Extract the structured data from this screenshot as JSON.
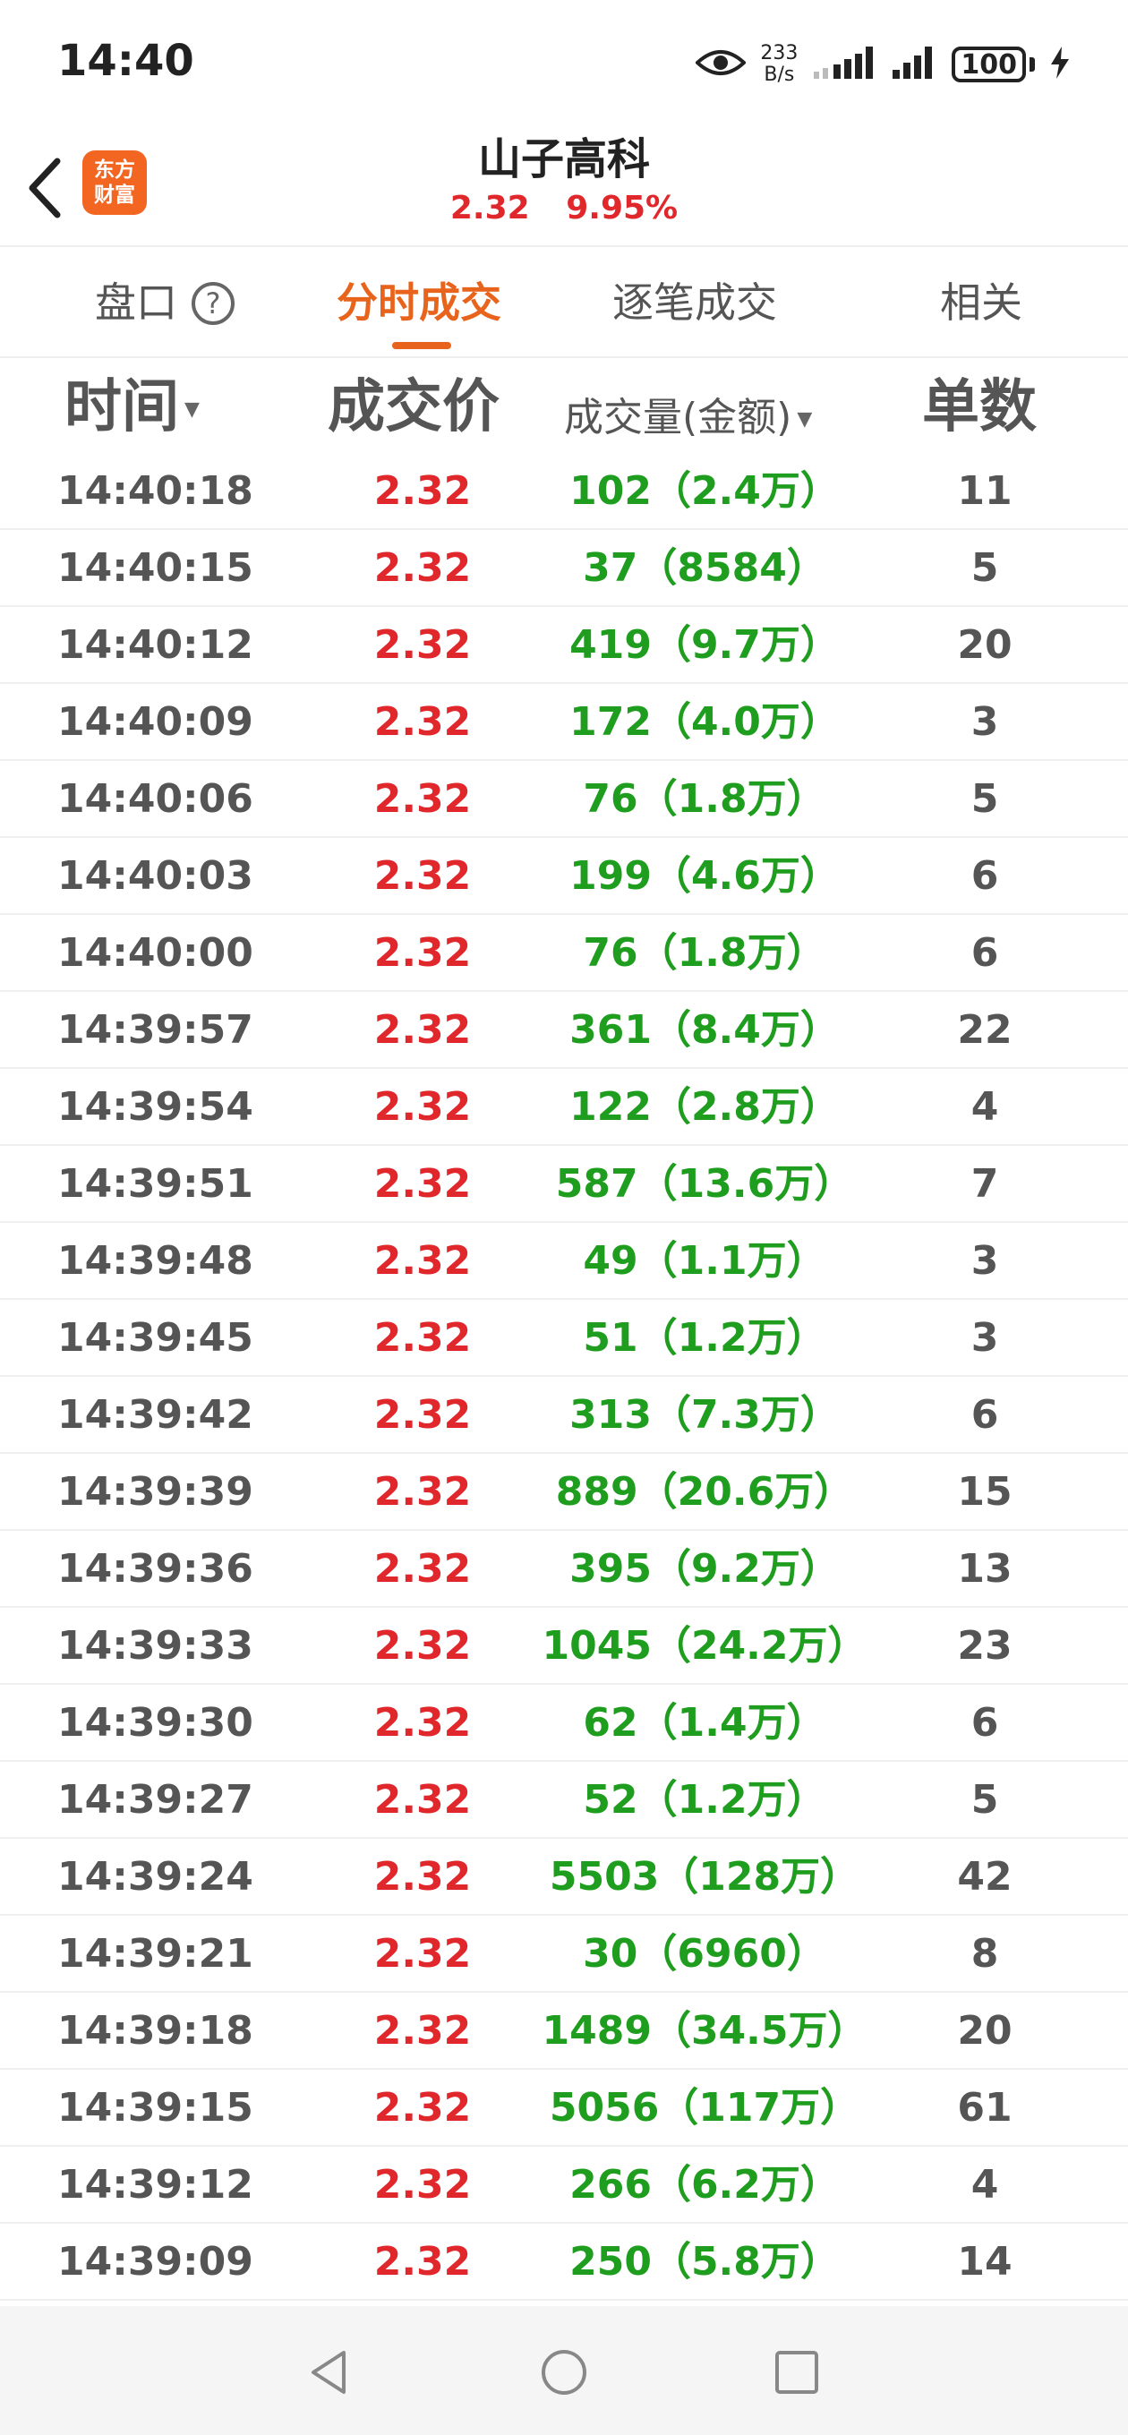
{
  "status_bar": {
    "time": "14:40",
    "net_speed_value": "233",
    "net_speed_unit": "B/s",
    "battery": "100",
    "icons": [
      "eye-icon",
      "signal-icon",
      "signal-icon",
      "charging-icon"
    ]
  },
  "header": {
    "back_icon": "chevron-left-icon",
    "logo_line1": "东方",
    "logo_line2": "财富",
    "title": "山子高科",
    "price": "2.32",
    "change_pct": "9.95%"
  },
  "tabs": [
    {
      "label": "盘口",
      "active": false
    },
    {
      "label": "分时成交",
      "active": true
    },
    {
      "label": "逐笔成交",
      "active": false
    },
    {
      "label": "相关",
      "active": false
    }
  ],
  "table": {
    "headers": {
      "time": "时间",
      "price": "成交价",
      "volume": "成交量(金额)",
      "count": "单数"
    },
    "rows": [
      {
        "time": "14:40:18",
        "price": "2.32",
        "volume": "102（2.4万）",
        "count": "11"
      },
      {
        "time": "14:40:15",
        "price": "2.32",
        "volume": "37（8584）",
        "count": "5"
      },
      {
        "time": "14:40:12",
        "price": "2.32",
        "volume": "419（9.7万）",
        "count": "20"
      },
      {
        "time": "14:40:09",
        "price": "2.32",
        "volume": "172（4.0万）",
        "count": "3"
      },
      {
        "time": "14:40:06",
        "price": "2.32",
        "volume": "76（1.8万）",
        "count": "5"
      },
      {
        "time": "14:40:03",
        "price": "2.32",
        "volume": "199（4.6万）",
        "count": "6"
      },
      {
        "time": "14:40:00",
        "price": "2.32",
        "volume": "76（1.8万）",
        "count": "6"
      },
      {
        "time": "14:39:57",
        "price": "2.32",
        "volume": "361（8.4万）",
        "count": "22"
      },
      {
        "time": "14:39:54",
        "price": "2.32",
        "volume": "122（2.8万）",
        "count": "4"
      },
      {
        "time": "14:39:51",
        "price": "2.32",
        "volume": "587（13.6万）",
        "count": "7"
      },
      {
        "time": "14:39:48",
        "price": "2.32",
        "volume": "49（1.1万）",
        "count": "3"
      },
      {
        "time": "14:39:45",
        "price": "2.32",
        "volume": "51（1.2万）",
        "count": "3"
      },
      {
        "time": "14:39:42",
        "price": "2.32",
        "volume": "313（7.3万）",
        "count": "6"
      },
      {
        "time": "14:39:39",
        "price": "2.32",
        "volume": "889（20.6万）",
        "count": "15"
      },
      {
        "time": "14:39:36",
        "price": "2.32",
        "volume": "395（9.2万）",
        "count": "13"
      },
      {
        "time": "14:39:33",
        "price": "2.32",
        "volume": "1045（24.2万）",
        "count": "23"
      },
      {
        "time": "14:39:30",
        "price": "2.32",
        "volume": "62（1.4万）",
        "count": "6"
      },
      {
        "time": "14:39:27",
        "price": "2.32",
        "volume": "52（1.2万）",
        "count": "5"
      },
      {
        "time": "14:39:24",
        "price": "2.32",
        "volume": "5503（128万）",
        "count": "42"
      },
      {
        "time": "14:39:21",
        "price": "2.32",
        "volume": "30（6960）",
        "count": "8"
      },
      {
        "time": "14:39:18",
        "price": "2.32",
        "volume": "1489（34.5万）",
        "count": "20"
      },
      {
        "time": "14:39:15",
        "price": "2.32",
        "volume": "5056（117万）",
        "count": "61"
      },
      {
        "time": "14:39:12",
        "price": "2.32",
        "volume": "266（6.2万）",
        "count": "4"
      },
      {
        "time": "14:39:09",
        "price": "2.32",
        "volume": "250（5.8万）",
        "count": "14"
      }
    ]
  },
  "colors": {
    "up_red": "#e0272b",
    "volume_green": "#1f9d1f",
    "accent_orange": "#e8641c",
    "logo_orange": "#f26622"
  },
  "navbar": {
    "icons": [
      "back-triangle-icon",
      "home-circle-icon",
      "recents-square-icon"
    ]
  }
}
